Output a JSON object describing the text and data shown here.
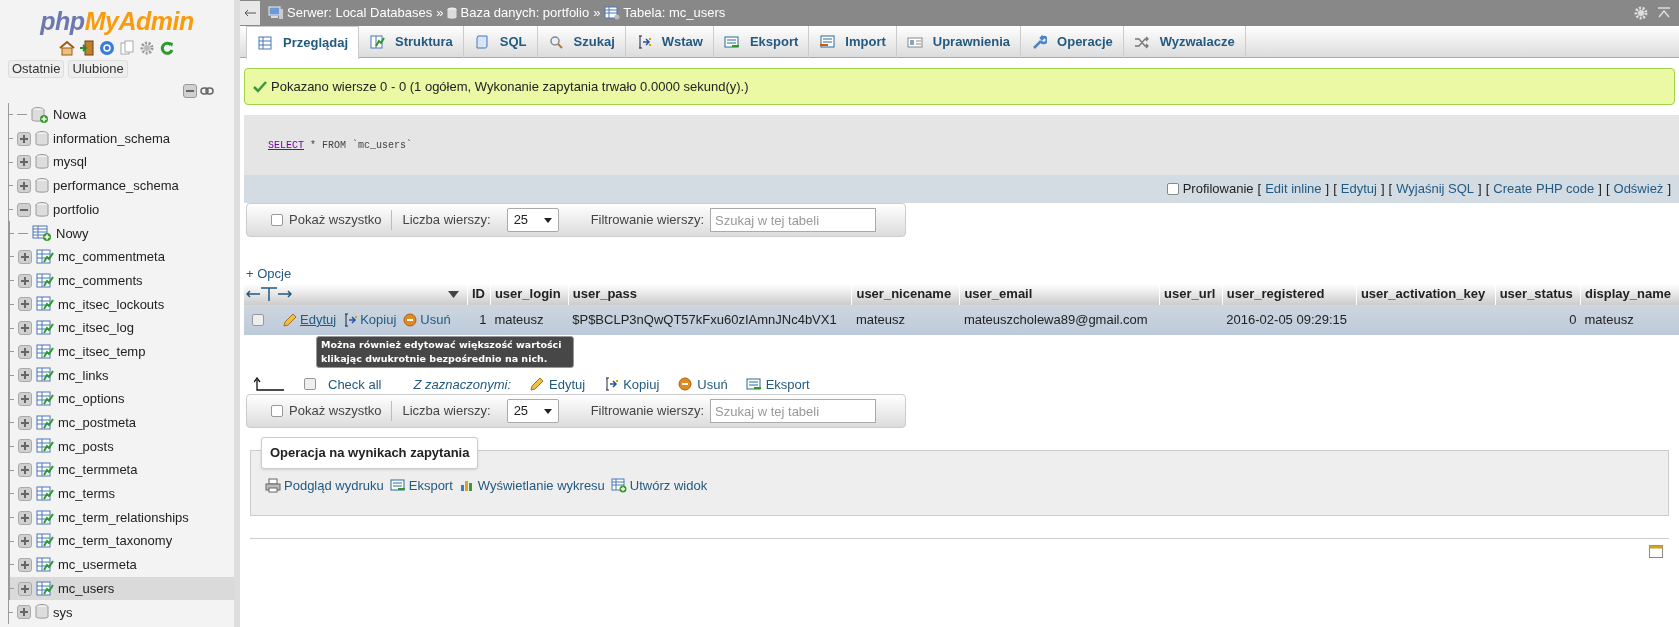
{
  "sidebar": {
    "logo": {
      "part_1": "php",
      "part_2": "MyAdmin"
    },
    "buttons": [
      "Ostatnie",
      "Ulubione"
    ],
    "tree": [
      {
        "label": "Nowa",
        "kind": "new"
      },
      {
        "label": "information_schema",
        "kind": "db",
        "expanded": false
      },
      {
        "label": "mysql",
        "kind": "db",
        "expanded": false
      },
      {
        "label": "performance_schema",
        "kind": "db",
        "expanded": false
      },
      {
        "label": "portfolio",
        "kind": "db",
        "expanded": true,
        "children": [
          {
            "label": "Nowy",
            "kind": "new_table"
          },
          {
            "label": "mc_commentmeta",
            "kind": "table",
            "expanded": false,
            "selected": false
          },
          {
            "label": "mc_comments",
            "kind": "table",
            "expanded": false,
            "selected": false
          },
          {
            "label": "mc_itsec_lockouts",
            "kind": "table",
            "expanded": false,
            "selected": false
          },
          {
            "label": "mc_itsec_log",
            "kind": "table",
            "expanded": false,
            "selected": false
          },
          {
            "label": "mc_itsec_temp",
            "kind": "table",
            "expanded": false,
            "selected": false
          },
          {
            "label": "mc_links",
            "kind": "table",
            "expanded": false,
            "selected": false
          },
          {
            "label": "mc_options",
            "kind": "table",
            "expanded": false,
            "selected": false
          },
          {
            "label": "mc_postmeta",
            "kind": "table",
            "expanded": false,
            "selected": false
          },
          {
            "label": "mc_posts",
            "kind": "table",
            "expanded": false,
            "selected": false
          },
          {
            "label": "mc_termmeta",
            "kind": "table",
            "expanded": false,
            "selected": false
          },
          {
            "label": "mc_terms",
            "kind": "table",
            "expanded": false,
            "selected": false
          },
          {
            "label": "mc_term_relationships",
            "kind": "table",
            "expanded": false,
            "selected": false
          },
          {
            "label": "mc_term_taxonomy",
            "kind": "table",
            "expanded": false,
            "selected": false
          },
          {
            "label": "mc_usermeta",
            "kind": "table",
            "expanded": false,
            "selected": false
          },
          {
            "label": "mc_users",
            "kind": "table",
            "expanded": false,
            "selected": true
          }
        ]
      },
      {
        "label": "sys",
        "kind": "db",
        "expanded": false
      }
    ]
  },
  "breadcrumb": {
    "separator": "»",
    "items": [
      {
        "kind": "server",
        "label": "Serwer: Local Databases"
      },
      {
        "kind": "db",
        "label": "Baza danych: portfolio"
      },
      {
        "kind": "table",
        "label": "Tabela: mc_users"
      }
    ]
  },
  "tabs": [
    {
      "label": "Przeglądaj",
      "kind": "browse",
      "selected": true
    },
    {
      "label": "Struktura",
      "kind": "structure",
      "selected": false
    },
    {
      "label": "SQL",
      "kind": "sql",
      "selected": false
    },
    {
      "label": "Szukaj",
      "kind": "search",
      "selected": false
    },
    {
      "label": "Wstaw",
      "kind": "insert",
      "selected": false
    },
    {
      "label": "Eksport",
      "kind": "export",
      "selected": false
    },
    {
      "label": "Import",
      "kind": "import",
      "selected": false
    },
    {
      "label": "Uprawnienia",
      "kind": "privileges",
      "selected": false
    },
    {
      "label": "Operacje",
      "kind": "operations",
      "selected": false
    },
    {
      "label": "Wyzwalacze",
      "kind": "triggers",
      "selected": false
    }
  ],
  "message": "Pokazano wiersze 0 - 0 (1 ogółem, Wykonanie zapytania trwało 0.0000 sekund(y).)",
  "sql": {
    "keyword": "SELECT",
    "rest": "* FROM `mc_users`"
  },
  "profiling": {
    "label": "Profilowanie",
    "checked": false,
    "links": [
      {
        "before": "[",
        "label": "Edit inline",
        "after": "]"
      },
      {
        "before": "[",
        "label": "Edytuj",
        "after": "]"
      },
      {
        "before": "[",
        "label": "Wyjaśnij SQL",
        "after": "]"
      },
      {
        "before": "[",
        "label": "Create PHP code",
        "after": "]"
      },
      {
        "before": "[",
        "label": "Odśwież",
        "after": "]"
      }
    ]
  },
  "navigation": [
    {
      "show_all": "Pokaż wszystko",
      "show_all_checked": false,
      "rows_label": "Liczba wierszy:",
      "rows_value": "25",
      "filter_label": "Filtrowanie wierszy:",
      "filter_placeholder": "Szukaj w tej tabeli"
    },
    {
      "show_all": "Pokaż wszystko",
      "show_all_checked": false,
      "rows_label": "Liczba wierszy:",
      "rows_value": "25",
      "filter_label": "Filtrowanie wierszy:",
      "filter_placeholder": "Szukaj w tej tabeli"
    }
  ],
  "options_link": "+ Opcje",
  "table": {
    "columns": [
      {
        "label": "ID",
        "numeric": true
      },
      {
        "label": "user_login",
        "numeric": false
      },
      {
        "label": "user_pass",
        "numeric": false
      },
      {
        "label": "user_nicename",
        "numeric": false
      },
      {
        "label": "user_email",
        "numeric": false
      },
      {
        "label": "user_url",
        "numeric": false
      },
      {
        "label": "user_registered",
        "numeric": false
      },
      {
        "label": "user_activation_key",
        "numeric": false
      },
      {
        "label": "user_status",
        "numeric": true
      },
      {
        "label": "display_name",
        "numeric": false
      }
    ],
    "rows": [
      {
        "selected": false,
        "actions": [
          {
            "kind": "edit",
            "label": "Edytuj"
          },
          {
            "kind": "copy",
            "label": "Kopiuj"
          },
          {
            "kind": "delete",
            "label": "Usuń"
          }
        ],
        "cells": [
          "1",
          "mateusz",
          "$P$BCLP3nQwQT57kFxu60zIAmnJNc4bVX1",
          "mateusz",
          "mateuszcholewa89@gmail.com",
          null,
          "2016-02-05 09:29:15",
          null,
          "0",
          "mateusz"
        ]
      }
    ]
  },
  "tooltip": "Można również edytować większość wartości klikając dwukrotnie bezpośrednio na nich.",
  "bulk": {
    "check_all": "Check all",
    "checked": false,
    "with_selected": "Z zaznaczonymi:",
    "actions": [
      {
        "kind": "edit",
        "label": "Edytuj"
      },
      {
        "kind": "copy",
        "label": "Kopiuj"
      },
      {
        "kind": "delete",
        "label": "Usuń"
      },
      {
        "kind": "export",
        "label": "Eksport"
      }
    ]
  },
  "query_operations": {
    "legend": "Operacja na wynikach zapytania",
    "actions": [
      {
        "kind": "print",
        "label": "Podgląd wydruku"
      },
      {
        "kind": "export",
        "label": "Eksport"
      },
      {
        "kind": "chart",
        "label": "Wyświetlanie wykresu"
      },
      {
        "kind": "view",
        "label": "Utwórz widok"
      }
    ]
  }
}
